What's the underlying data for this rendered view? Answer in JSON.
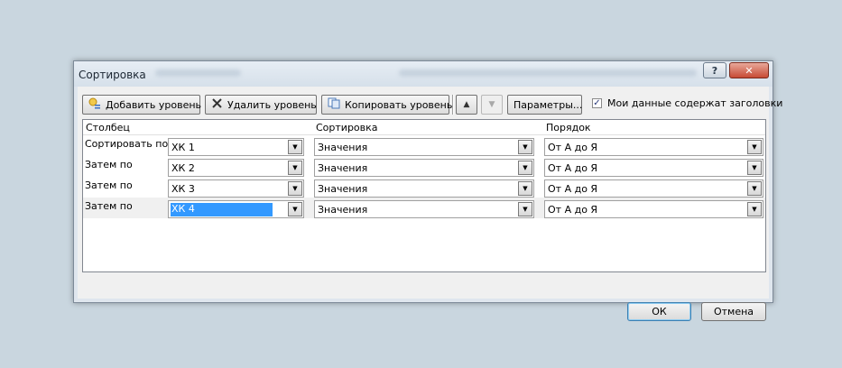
{
  "dialog": {
    "title": "Сортировка",
    "help_label": "?",
    "close_label": "✕"
  },
  "toolbar": {
    "add_level": "Добавить уровень",
    "delete_level": "Удалить уровень",
    "copy_level": "Копировать уровень",
    "move_up": "▲",
    "move_down": "▼",
    "options": "Параметры...",
    "headers_checkbox": "Мои данные содержат заголовки",
    "headers_checked": true
  },
  "grid": {
    "headers": [
      "Столбец",
      "Сортировка",
      "Порядок"
    ],
    "rows": [
      {
        "label": "Сортировать по",
        "column": "ХК 1",
        "sort_on": "Значения",
        "order": "От А до Я",
        "selected": false
      },
      {
        "label": "Затем по",
        "column": "ХК 2",
        "sort_on": "Значения",
        "order": "От А до Я",
        "selected": false
      },
      {
        "label": "Затем по",
        "column": "ХК 3",
        "sort_on": "Значения",
        "order": "От А до Я",
        "selected": false
      },
      {
        "label": "Затем по",
        "column": "ХК 4",
        "sort_on": "Значения",
        "order": "От А до Я",
        "selected": true
      }
    ]
  },
  "footer": {
    "ok": "ОК",
    "cancel": "Отмена"
  }
}
